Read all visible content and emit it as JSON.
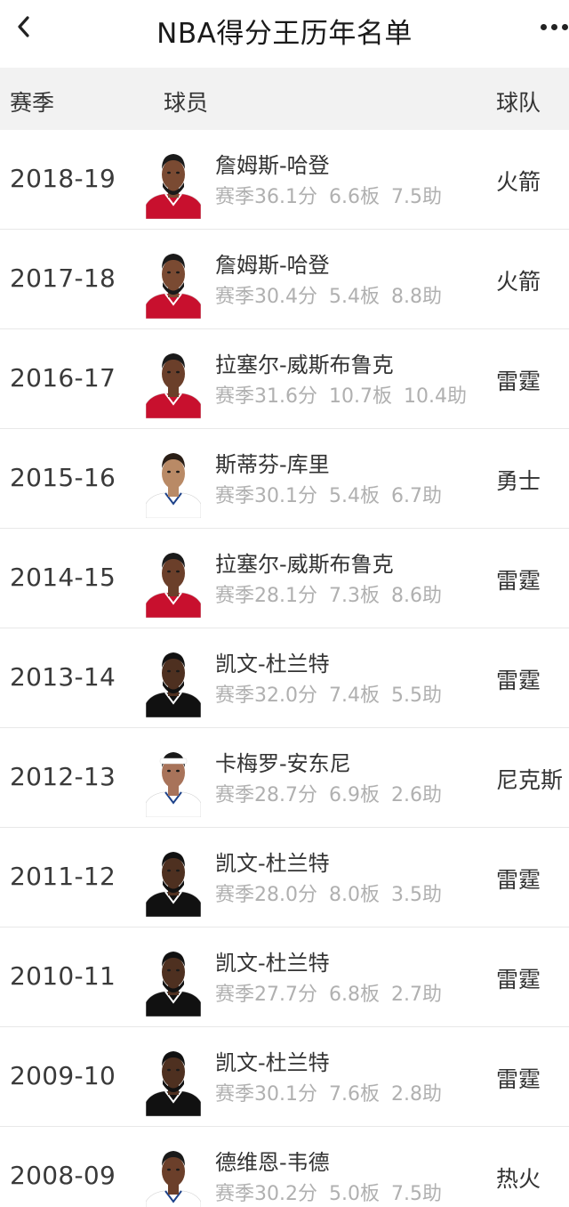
{
  "nav": {
    "title": "NBA得分王历年名单",
    "back_icon": "chevron-left-icon",
    "more_icon": "more-dots-icon"
  },
  "header": {
    "season": "赛季",
    "player": "球员",
    "team": "球队"
  },
  "colors": {
    "header_bg": "#f2f2f2",
    "stats_text": "#b0b0b0",
    "divider": "#e8e8e8"
  },
  "rows": [
    {
      "season": "2018-19",
      "player": "詹姆斯-哈登",
      "pts": "赛季36.1分",
      "reb": "6.6板",
      "ast": "7.5助",
      "team": "火箭",
      "jersey": "#c8102e",
      "skin": "#7a4a32",
      "hair": "#1a1a1a",
      "beard": true,
      "headband": ""
    },
    {
      "season": "2017-18",
      "player": "詹姆斯-哈登",
      "pts": "赛季30.4分",
      "reb": "5.4板",
      "ast": "8.8助",
      "team": "火箭",
      "jersey": "#c8102e",
      "skin": "#7a4a32",
      "hair": "#1a1a1a",
      "beard": true,
      "headband": ""
    },
    {
      "season": "2016-17",
      "player": "拉塞尔-威斯布鲁克",
      "pts": "赛季31.6分",
      "reb": "10.7板",
      "ast": "10.4助",
      "team": "雷霆",
      "jersey": "#c8102e",
      "skin": "#6b3f2a",
      "hair": "#1a1a1a",
      "beard": false,
      "headband": ""
    },
    {
      "season": "2015-16",
      "player": "斯蒂芬-库里",
      "pts": "赛季30.1分",
      "reb": "5.4板",
      "ast": "6.7助",
      "team": "勇士",
      "jersey": "#ffffff",
      "skin": "#b98a66",
      "hair": "#2a1e16",
      "beard": false,
      "headband": ""
    },
    {
      "season": "2014-15",
      "player": "拉塞尔-威斯布鲁克",
      "pts": "赛季28.1分",
      "reb": "7.3板",
      "ast": "8.6助",
      "team": "雷霆",
      "jersey": "#c8102e",
      "skin": "#6b3f2a",
      "hair": "#1a1a1a",
      "beard": false,
      "headband": ""
    },
    {
      "season": "2013-14",
      "player": "凯文-杜兰特",
      "pts": "赛季32.0分",
      "reb": "7.4板",
      "ast": "5.5助",
      "team": "雷霆",
      "jersey": "#111111",
      "skin": "#4e3020",
      "hair": "#111111",
      "beard": true,
      "headband": ""
    },
    {
      "season": "2012-13",
      "player": "卡梅罗-安东尼",
      "pts": "赛季28.7分",
      "reb": "6.9板",
      "ast": "2.6助",
      "team": "尼克斯",
      "jersey": "#ffffff",
      "skin": "#a8735a",
      "hair": "#1a1a1a",
      "beard": false,
      "headband": "#ffffff"
    },
    {
      "season": "2011-12",
      "player": "凯文-杜兰特",
      "pts": "赛季28.0分",
      "reb": "8.0板",
      "ast": "3.5助",
      "team": "雷霆",
      "jersey": "#111111",
      "skin": "#4e3020",
      "hair": "#111111",
      "beard": true,
      "headband": ""
    },
    {
      "season": "2010-11",
      "player": "凯文-杜兰特",
      "pts": "赛季27.7分",
      "reb": "6.8板",
      "ast": "2.7助",
      "team": "雷霆",
      "jersey": "#111111",
      "skin": "#4e3020",
      "hair": "#111111",
      "beard": true,
      "headband": ""
    },
    {
      "season": "2009-10",
      "player": "凯文-杜兰特",
      "pts": "赛季30.1分",
      "reb": "7.6板",
      "ast": "2.8助",
      "team": "雷霆",
      "jersey": "#111111",
      "skin": "#4e3020",
      "hair": "#111111",
      "beard": true,
      "headband": ""
    },
    {
      "season": "2008-09",
      "player": "德维恩-韦德",
      "pts": "赛季30.2分",
      "reb": "5.0板",
      "ast": "7.5助",
      "team": "热火",
      "jersey": "#ffffff",
      "skin": "#6b3f2a",
      "hair": "#1a1a1a",
      "beard": false,
      "headband": ""
    }
  ]
}
